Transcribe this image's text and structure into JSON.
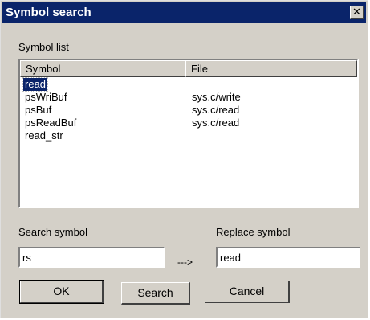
{
  "dialog": {
    "title": "Symbol search",
    "close_glyph": "✕"
  },
  "symbol_list": {
    "label": "Symbol list",
    "columns": [
      "Symbol",
      "File"
    ],
    "rows": [
      {
        "symbol": "read",
        "file": "",
        "selected": true
      },
      {
        "symbol": "psWriBuf",
        "file": "sys.c/write",
        "selected": false
      },
      {
        "symbol": "psBuf",
        "file": "sys.c/read",
        "selected": false
      },
      {
        "symbol": "psReadBuf",
        "file": "sys.c/read",
        "selected": false
      },
      {
        "symbol": "read_str",
        "file": "",
        "selected": false
      }
    ]
  },
  "search": {
    "label": "Search symbol",
    "value": "rs"
  },
  "arrow_text": "--->",
  "replace": {
    "label": "Replace symbol",
    "value": "read"
  },
  "buttons": {
    "ok": "OK",
    "search": "Search",
    "cancel": "Cancel"
  },
  "colors": {
    "titlebar": "#0a246a",
    "face": "#d4d0c8",
    "selection": "#0a246a"
  },
  "icons": {
    "close": "close-icon"
  }
}
